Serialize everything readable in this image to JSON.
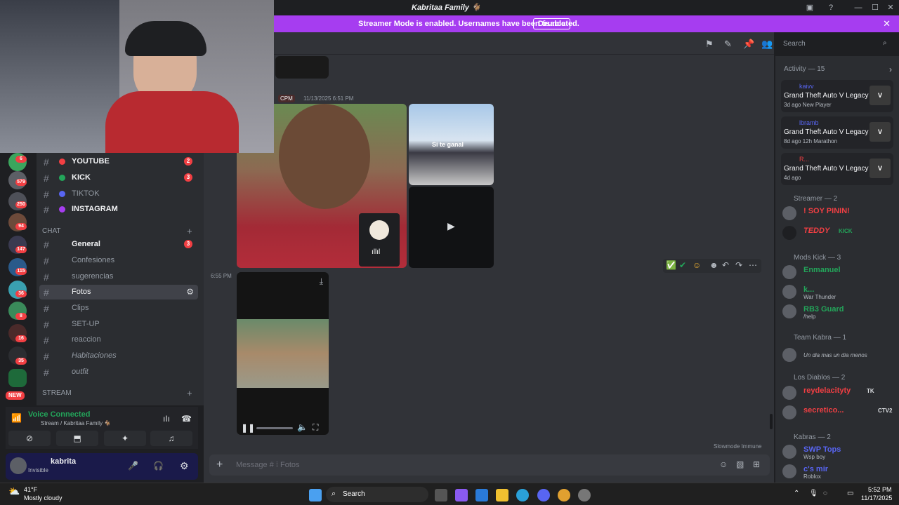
{
  "window": {
    "title": "Kabritaa Family 🐐"
  },
  "banner": {
    "text": "Streamer Mode is enabled. Usernames have been truncated.",
    "button": "Disable"
  },
  "guild_badges": [
    "6",
    "579",
    "250",
    "94",
    "147",
    "115",
    "36",
    "8",
    "16",
    "35",
    "NEW"
  ],
  "channels": [
    {
      "name": "YOUTUBE",
      "count": "2"
    },
    {
      "name": "KICK",
      "count": "3"
    },
    {
      "name": "TIKTOK",
      "count": ""
    },
    {
      "name": "INSTAGRAM",
      "count": ""
    }
  ],
  "chat_category": "CHAT",
  "chat_channels": [
    {
      "name": "General",
      "count": "3"
    },
    {
      "name": "Confesiones",
      "count": ""
    },
    {
      "name": "sugerencias",
      "count": ""
    },
    {
      "name": "Fotos",
      "count": ""
    },
    {
      "name": "Clips",
      "count": ""
    },
    {
      "name": "SET-UP",
      "count": ""
    },
    {
      "name": "reaccion",
      "count": ""
    },
    {
      "name": "Habitaciones",
      "count": ""
    },
    {
      "name": "outfit",
      "count": ""
    }
  ],
  "stream_category": "STREAM",
  "voice": {
    "status": "Voice Connected",
    "channel": "Stream / Kabritaa Family 🐐"
  },
  "user": {
    "name": "kabrita",
    "status": "Invisible"
  },
  "message": {
    "role": "CPM",
    "timestamp": "11/13/2025 6:51 PM",
    "time2": "6:55 PM",
    "overlay_text": "Si te ganal"
  },
  "input": {
    "placeholder": "Message # ⁞ Fotos",
    "slowmode": "Slowmode Immune"
  },
  "search": {
    "placeholder": "Search"
  },
  "activity": {
    "header": "Activity — 15",
    "items": [
      {
        "user": "kaivv",
        "game": "Grand Theft Auto V Legacy",
        "sub": "3d ago   New Player"
      },
      {
        "user": "lbramb",
        "game": "Grand Theft Auto V Legacy",
        "sub": "8d ago   12h Marathon"
      },
      {
        "user": "R...",
        "game": "Grand Theft Auto V Legacy",
        "sub": "4d ago"
      }
    ]
  },
  "sections": [
    {
      "title": "Streamer — 2"
    },
    {
      "title": "Mods Kick — 3"
    },
    {
      "title": "Team Kabra — 1"
    },
    {
      "title": "Los Diablos — 2"
    },
    {
      "title": "Kabras — 2"
    }
  ],
  "members": [
    {
      "name": "! SOY PININ!",
      "sub": "",
      "color": "#f23f43"
    },
    {
      "name": "TEDDY",
      "sub": "KICK",
      "color": "#f23f43"
    },
    {
      "name": "Enmanuel",
      "sub": "",
      "color": "#23a55a"
    },
    {
      "name": "k...",
      "sub": "War Thunder",
      "color": "#23a55a"
    },
    {
      "name": "RB3 Guard",
      "sub": "/help",
      "color": "#23a55a"
    },
    {
      "name": "",
      "sub": "Un dia mas un dia menos",
      "color": "#dbdee1"
    },
    {
      "name": "reydelacityty",
      "sub": "TK",
      "color": "#f23f43"
    },
    {
      "name": "secretico...",
      "sub": "CTV2",
      "color": "#f23f43"
    },
    {
      "name": "SWP Tops",
      "sub": "Wsp boy",
      "color": "#5865f2"
    },
    {
      "name": "c's mir",
      "sub": "Roblox",
      "color": "#5865f2"
    }
  ],
  "taskbar": {
    "weather_temp": "41°F",
    "weather_desc": "Mostly cloudy",
    "search": "Search",
    "time": "5:52 PM",
    "date": "11/17/2025"
  }
}
